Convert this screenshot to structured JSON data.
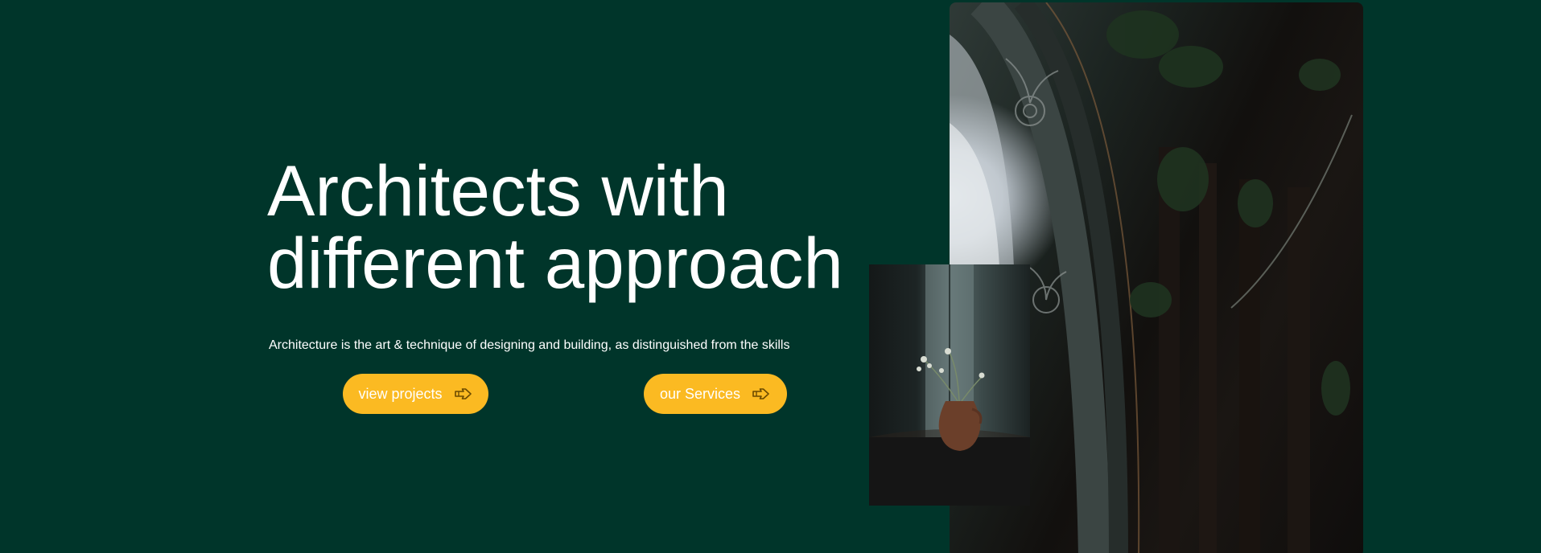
{
  "hero": {
    "headline_line1": "Architects with",
    "headline_line2": "different approach",
    "subtext": "Architecture is the art & technique of designing and building, as distinguished from the skills"
  },
  "buttons": {
    "projects_label": "view projects",
    "services_label": "our Services",
    "icon": "hand-pointing-right-icon"
  },
  "images": {
    "large": "ornate-arched-interior-with-plant-photo",
    "small": "vase-with-flowers-by-window-photo"
  },
  "colors": {
    "background": "#00352a",
    "button": "#fbba22",
    "text": "#ffffff"
  }
}
